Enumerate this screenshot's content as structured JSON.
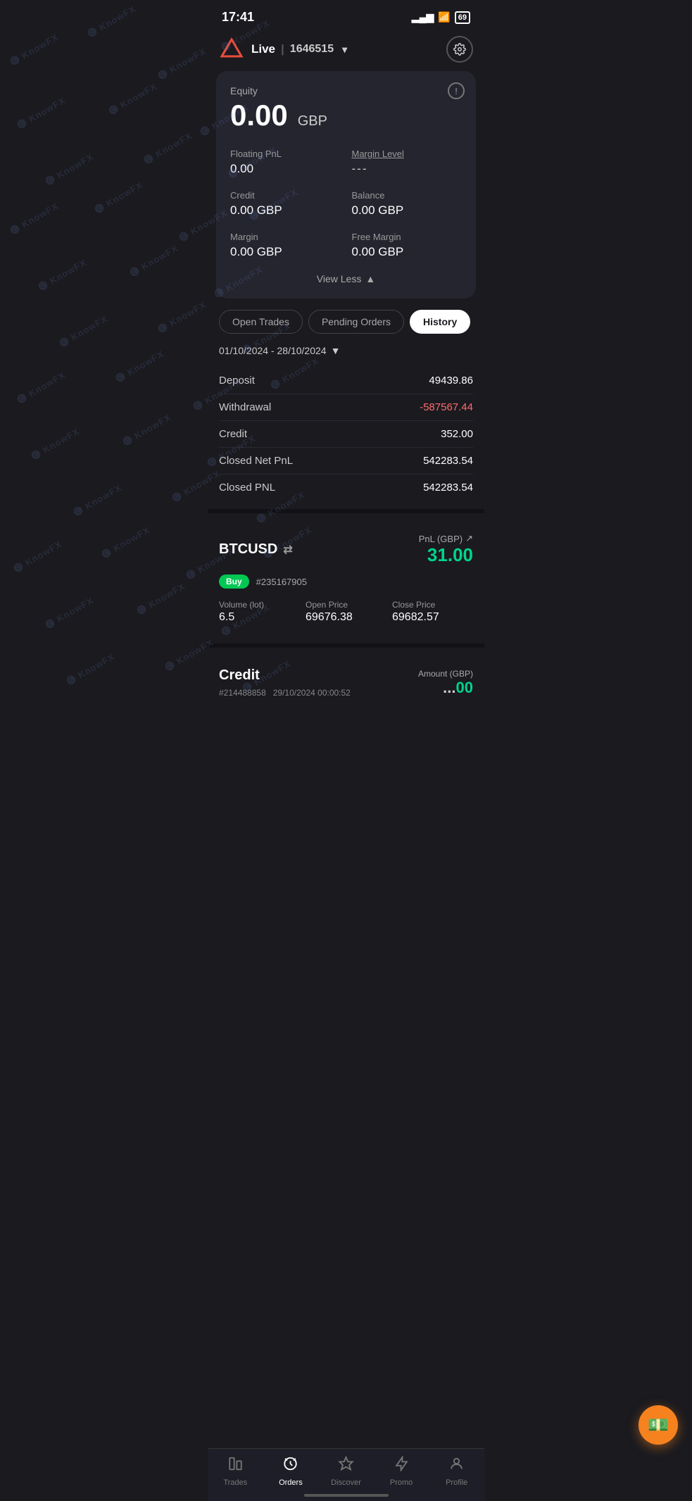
{
  "statusBar": {
    "time": "17:41",
    "battery": "69",
    "signal": "▂▄▆",
    "wifi": "WiFi"
  },
  "header": {
    "mode": "Live",
    "accountId": "1646515",
    "settingsIcon": "settings"
  },
  "accountCard": {
    "equityLabel": "Equity",
    "equityValue": "0.00",
    "equityCurrency": "GBP",
    "floatingPnlLabel": "Floating PnL",
    "floatingPnlValue": "0.00",
    "marginLevelLabel": "Margin Level",
    "marginLevelValue": "---",
    "creditLabel": "Credit",
    "creditValue": "0.00 GBP",
    "balanceLabel": "Balance",
    "balanceValue": "0.00 GBP",
    "marginLabel": "Margin",
    "marginValue": "0.00 GBP",
    "freeMarginLabel": "Free Margin",
    "freeMarginValue": "0.00 GBP",
    "viewLessLabel": "View Less"
  },
  "tabs": {
    "openTrades": "Open Trades",
    "pendingOrders": "Pending Orders",
    "history": "History",
    "activeTab": "history"
  },
  "history": {
    "dateRange": "01/10/2024 - 28/10/2024",
    "rows": [
      {
        "label": "Deposit",
        "value": "49439.86",
        "negative": false
      },
      {
        "label": "Withdrawal",
        "value": "-587567.44",
        "negative": true
      },
      {
        "label": "Credit",
        "value": "352.00",
        "negative": false
      },
      {
        "label": "Closed Net PnL",
        "value": "542283.54",
        "negative": false
      },
      {
        "label": "Closed PNL",
        "value": "542283.54",
        "negative": false
      }
    ]
  },
  "trade": {
    "symbol": "BTCUSD",
    "symbolIcon": "⇄",
    "pnlLabel": "PnL (GBP)",
    "pnlValue": "31.00",
    "direction": "Buy",
    "orderId": "#235167905",
    "volumeLabel": "Volume (lot)",
    "volumeValue": "6.5",
    "openPriceLabel": "Open Price",
    "openPriceValue": "69676.38",
    "closePriceLabel": "Close Price",
    "closePriceValue": "69682.57"
  },
  "credit": {
    "title": "Credit",
    "orderId": "#214488858",
    "datetime": "29/10/2024 00:00:52",
    "amountLabel": "Amount (GBP)",
    "amountValue": "00"
  },
  "bottomNav": {
    "items": [
      {
        "id": "trades",
        "label": "Trades",
        "icon": "📊",
        "active": false
      },
      {
        "id": "orders",
        "label": "Orders",
        "icon": "◎",
        "active": true
      },
      {
        "id": "discover",
        "label": "Discover",
        "icon": "◇",
        "active": false
      },
      {
        "id": "promo",
        "label": "Promo",
        "icon": "⚡",
        "active": false
      },
      {
        "id": "profile",
        "label": "Profile",
        "icon": "👤",
        "active": false
      }
    ]
  },
  "fab": {
    "icon": "💵"
  }
}
